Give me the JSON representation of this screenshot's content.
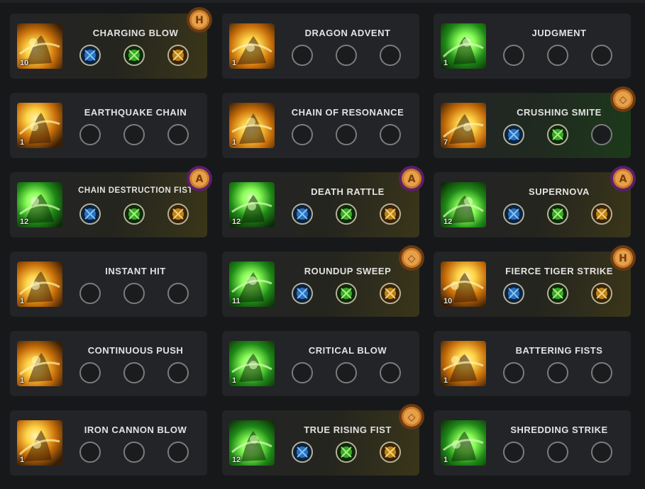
{
  "skills": [
    {
      "name": "CHARGING BLOW",
      "level": "10",
      "theme": "gold",
      "tier": "gold",
      "icon": "charging-blow-icon",
      "rune": "h",
      "slots": [
        {
          "color": "blue",
          "icon": "crossed-swords-icon"
        },
        {
          "color": "green",
          "icon": "swirl-icon"
        },
        {
          "color": "gold",
          "icon": "beast-icon"
        }
      ]
    },
    {
      "name": "DRAGON ADVENT",
      "level": "1",
      "theme": "gold",
      "tier": "plain",
      "icon": "dragon-advent-icon",
      "rune": null,
      "slots": [
        null,
        null,
        null
      ]
    },
    {
      "name": "JUDGMENT",
      "level": "1",
      "theme": "green",
      "tier": "plain",
      "icon": "judgment-icon",
      "rune": null,
      "slots": [
        null,
        null,
        null
      ]
    },
    {
      "name": "EARTHQUAKE CHAIN",
      "level": "1",
      "theme": "gold",
      "tier": "plain",
      "icon": "earthquake-chain-icon",
      "rune": null,
      "slots": [
        null,
        null,
        null
      ]
    },
    {
      "name": "CHAIN OF RESONANCE",
      "level": "1",
      "theme": "gold",
      "tier": "plain",
      "icon": "chain-of-resonance-icon",
      "rune": null,
      "slots": [
        null,
        null,
        null
      ]
    },
    {
      "name": "CRUSHING SMITE",
      "level": "7",
      "theme": "gold",
      "tier": "green",
      "icon": "crushing-smite-icon",
      "rune": "square",
      "slots": [
        {
          "color": "blue",
          "icon": "wave-icon"
        },
        {
          "color": "green",
          "icon": "plus-icon"
        },
        null
      ]
    },
    {
      "name": "CHAIN DESTRUCTION FIST",
      "level": "12",
      "theme": "green",
      "tier": "gold",
      "icon": "chain-destruction-fist-icon",
      "rune": "a",
      "small": true,
      "slots": [
        {
          "color": "blue",
          "icon": "crossed-swords-icon"
        },
        {
          "color": "green",
          "icon": "flame-icon"
        },
        {
          "color": "gold",
          "icon": "burst-icon"
        }
      ]
    },
    {
      "name": "DEATH RATTLE",
      "level": "12",
      "theme": "green",
      "tier": "gold",
      "icon": "death-rattle-icon",
      "rune": "a",
      "slots": [
        {
          "color": "blue",
          "icon": "hourglass-icon"
        },
        {
          "color": "green",
          "icon": "figure-icon"
        },
        {
          "color": "gold",
          "icon": "crossed-swords-icon"
        }
      ]
    },
    {
      "name": "SUPERNOVA",
      "level": "12",
      "theme": "green",
      "tier": "gold",
      "icon": "supernova-icon",
      "rune": "a",
      "slots": [
        {
          "color": "blue",
          "icon": "hourglass-icon"
        },
        {
          "color": "green",
          "icon": "dash-icon"
        },
        {
          "color": "gold",
          "icon": "crossed-swords-icon"
        }
      ]
    },
    {
      "name": "INSTANT HIT",
      "level": "1",
      "theme": "gold",
      "tier": "plain",
      "icon": "instant-hit-icon",
      "rune": null,
      "slots": [
        null,
        null,
        null
      ]
    },
    {
      "name": "ROUNDUP SWEEP",
      "level": "11",
      "theme": "green",
      "tier": "gold",
      "icon": "roundup-sweep-icon",
      "rune": "square",
      "slots": [
        {
          "color": "blue",
          "icon": "hourglass-icon"
        },
        {
          "color": "green",
          "icon": "ring-icon"
        },
        {
          "color": "gold",
          "icon": "slash-icon"
        }
      ]
    },
    {
      "name": "FIERCE TIGER STRIKE",
      "level": "10",
      "theme": "gold",
      "tier": "gold",
      "icon": "fierce-tiger-strike-icon",
      "rune": "h",
      "slots": [
        {
          "color": "blue",
          "icon": "wave-icon"
        },
        {
          "color": "green",
          "icon": "plus-icon"
        },
        {
          "color": "gold",
          "icon": "crossed-swords-icon"
        }
      ]
    },
    {
      "name": "CONTINUOUS PUSH",
      "level": "1",
      "theme": "gold",
      "tier": "plain",
      "icon": "continuous-push-icon",
      "rune": null,
      "slots": [
        null,
        null,
        null
      ]
    },
    {
      "name": "CRITICAL BLOW",
      "level": "1",
      "theme": "green",
      "tier": "plain",
      "icon": "critical-blow-icon",
      "rune": null,
      "slots": [
        null,
        null,
        null
      ]
    },
    {
      "name": "BATTERING FISTS",
      "level": "1",
      "theme": "gold",
      "tier": "plain",
      "icon": "battering-fists-icon",
      "rune": null,
      "slots": [
        null,
        null,
        null
      ]
    },
    {
      "name": "IRON CANNON BLOW",
      "level": "1",
      "theme": "gold",
      "tier": "plain",
      "icon": "iron-cannon-blow-icon",
      "rune": null,
      "slots": [
        null,
        null,
        null
      ]
    },
    {
      "name": "TRUE RISING FIST",
      "level": "12",
      "theme": "green",
      "tier": "gold",
      "icon": "true-rising-fist-icon",
      "rune": "square",
      "slots": [
        {
          "color": "blue",
          "icon": "lightning-icon"
        },
        {
          "color": "green",
          "icon": "beast-icon"
        },
        {
          "color": "gold",
          "icon": "target-icon"
        }
      ]
    },
    {
      "name": "SHREDDING STRIKE",
      "level": "1",
      "theme": "green",
      "tier": "plain",
      "icon": "shredding-strike-icon",
      "rune": null,
      "slots": [
        null,
        null,
        null
      ]
    }
  ],
  "colors": {
    "gold": "#e0a21c",
    "green": "#3fbf2a",
    "blue": "#2e7fd6"
  }
}
